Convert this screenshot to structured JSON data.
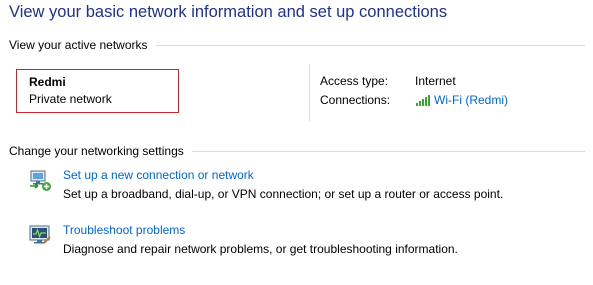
{
  "page": {
    "title": "View your basic network information and set up connections"
  },
  "active_networks": {
    "header": "View your active networks",
    "network": {
      "name": "Redmi",
      "category": "Private network"
    },
    "access_type_label": "Access type:",
    "access_type_value": "Internet",
    "connections_label": "Connections:",
    "connection_link": "Wi-Fi (Redmi)",
    "connection_icon": "wifi-signal-icon"
  },
  "change_settings": {
    "header": "Change your networking settings",
    "tasks": [
      {
        "icon": "new-connection-icon",
        "link": "Set up a new connection or network",
        "description": "Set up a broadband, dial-up, or VPN connection; or set up a router or access point."
      },
      {
        "icon": "troubleshoot-icon",
        "link": "Troubleshoot problems",
        "description": "Diagnose and repair network problems, or get troubleshooting information."
      }
    ]
  },
  "colors": {
    "title": "#1e3287",
    "link": "#0066cc",
    "highlight_border": "#c4282d",
    "divider": "#d5dfe5"
  }
}
